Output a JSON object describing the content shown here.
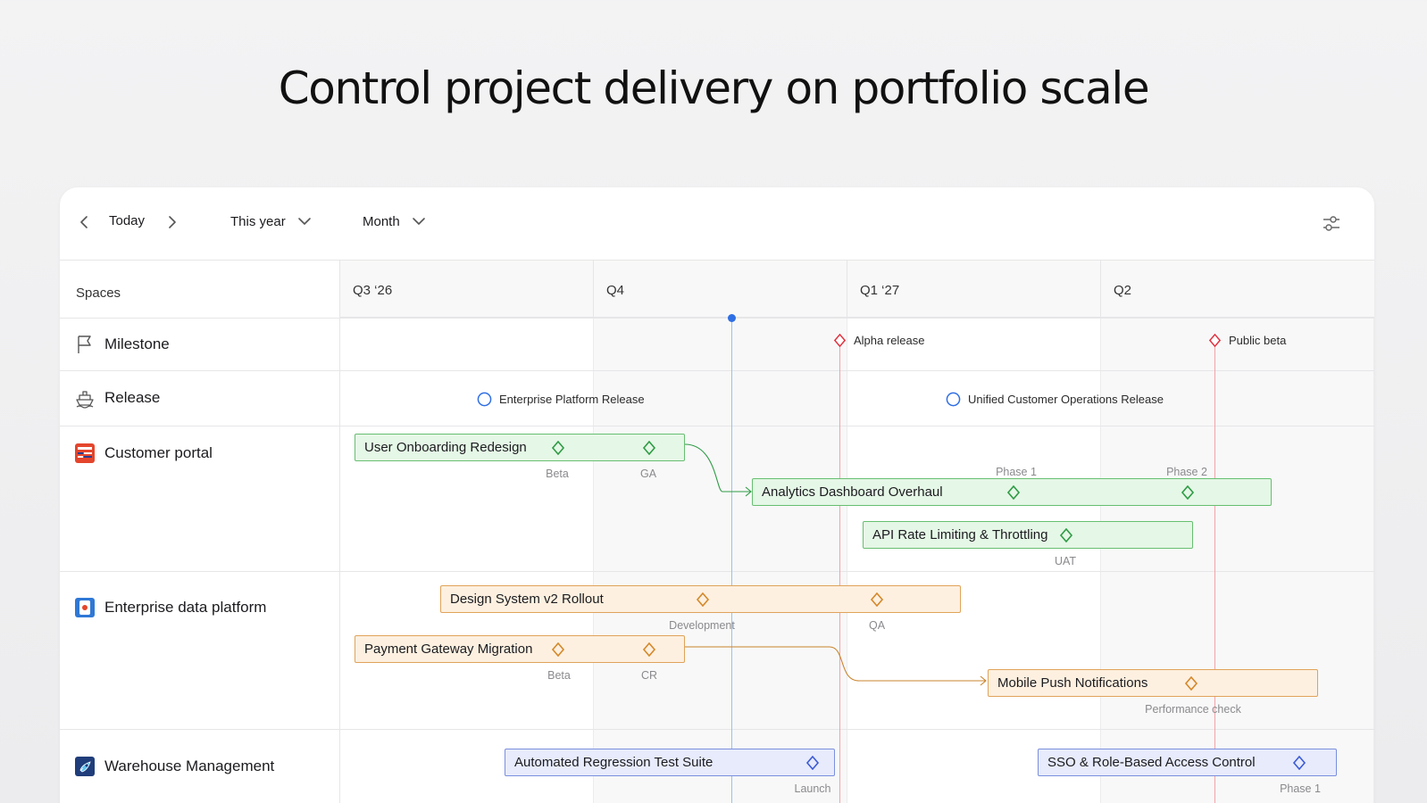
{
  "headline": "Control project delivery on portfolio scale",
  "toolbar": {
    "today_label": "Today",
    "range_label": "This year",
    "scale_label": "Month",
    "icons": [
      "chevron-left-icon",
      "chevron-right-icon",
      "chevron-down-icon",
      "filter-sliders-icon"
    ]
  },
  "timeline": {
    "spaces_header": "Spaces",
    "quarters": [
      "Q3 ‘26",
      "Q4",
      "Q1 ‘27",
      "Q2"
    ]
  },
  "rows": [
    {
      "label": "Milestone",
      "icon": "flag-icon"
    },
    {
      "label": "Release",
      "icon": "ship-icon"
    },
    {
      "label": "Customer portal",
      "icon": "portal-app-icon"
    },
    {
      "label": "Enterprise data platform",
      "icon": "data-platform-app-icon"
    },
    {
      "label": "Warehouse Management",
      "icon": "rocket-app-icon"
    }
  ],
  "milestones": [
    {
      "label": "Alpha release",
      "color": "#e0323f"
    },
    {
      "label": "Public beta",
      "color": "#e0323f"
    }
  ],
  "releases": [
    {
      "label": "Enterprise Platform Release",
      "color": "#2f6fe4"
    },
    {
      "label": "Unified Customer Operations Release",
      "color": "#2f6fe4"
    }
  ],
  "bars": [
    {
      "label": "User Onboarding Redesign",
      "color": "green",
      "checkpoints": [
        "Beta",
        "GA"
      ]
    },
    {
      "label": "Analytics Dashboard Overhaul",
      "color": "green",
      "checkpoints": [
        "Phase 1",
        "Phase 2"
      ]
    },
    {
      "label": "API Rate Limiting & Throttling",
      "color": "green",
      "checkpoints": [
        "UAT"
      ]
    },
    {
      "label": "Design System v2 Rollout",
      "color": "orange",
      "checkpoints": [
        "Development",
        "QA"
      ]
    },
    {
      "label": "Payment Gateway Migration",
      "color": "orange",
      "checkpoints": [
        "Beta",
        "CR"
      ]
    },
    {
      "label": "Mobile Push Notifications",
      "color": "orange",
      "checkpoints": [
        "Performance check"
      ]
    },
    {
      "label": "Automated Regression Test Suite",
      "color": "blue",
      "checkpoints": [
        "Launch"
      ]
    },
    {
      "label": "SSO & Role-Based Access Control",
      "color": "blue",
      "checkpoints": [
        "Phase 1"
      ]
    }
  ],
  "colors": {
    "today_line": "#2f6fe4",
    "milestone_line": "#f2a3a8",
    "green_diamond": "#2e9b45",
    "orange_diamond": "#d5882a",
    "blue_diamond": "#3d5bd6"
  }
}
